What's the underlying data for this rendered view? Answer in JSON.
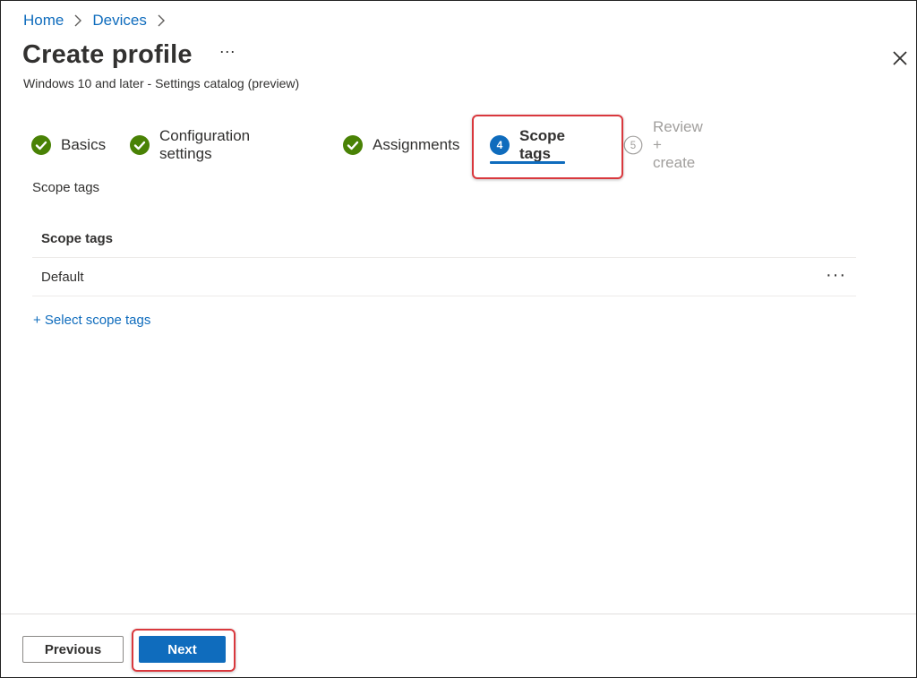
{
  "breadcrumb": {
    "home": "Home",
    "devices": "Devices"
  },
  "header": {
    "title": "Create profile",
    "more": "···",
    "subtitle": "Windows 10 and later - Settings catalog (preview)"
  },
  "steps": [
    {
      "label": "Basics",
      "state": "completed"
    },
    {
      "label": "Configuration settings",
      "state": "completed"
    },
    {
      "label": "Assignments",
      "state": "completed"
    },
    {
      "label": "Scope tags",
      "state": "current",
      "number": "4"
    },
    {
      "label": "Review + create",
      "state": "upcoming",
      "number": "5"
    }
  ],
  "content": {
    "section_label": "Scope tags",
    "table": {
      "header": "Scope tags",
      "rows": [
        {
          "name": "Default",
          "more": "···"
        }
      ]
    },
    "add_link": "+ Select scope tags"
  },
  "footer": {
    "previous": "Previous",
    "next": "Next"
  },
  "colors": {
    "accent": "#0f6cbd",
    "success": "#498205",
    "highlight": "#d9383d",
    "text": "#323130",
    "muted": "#a19f9d"
  }
}
